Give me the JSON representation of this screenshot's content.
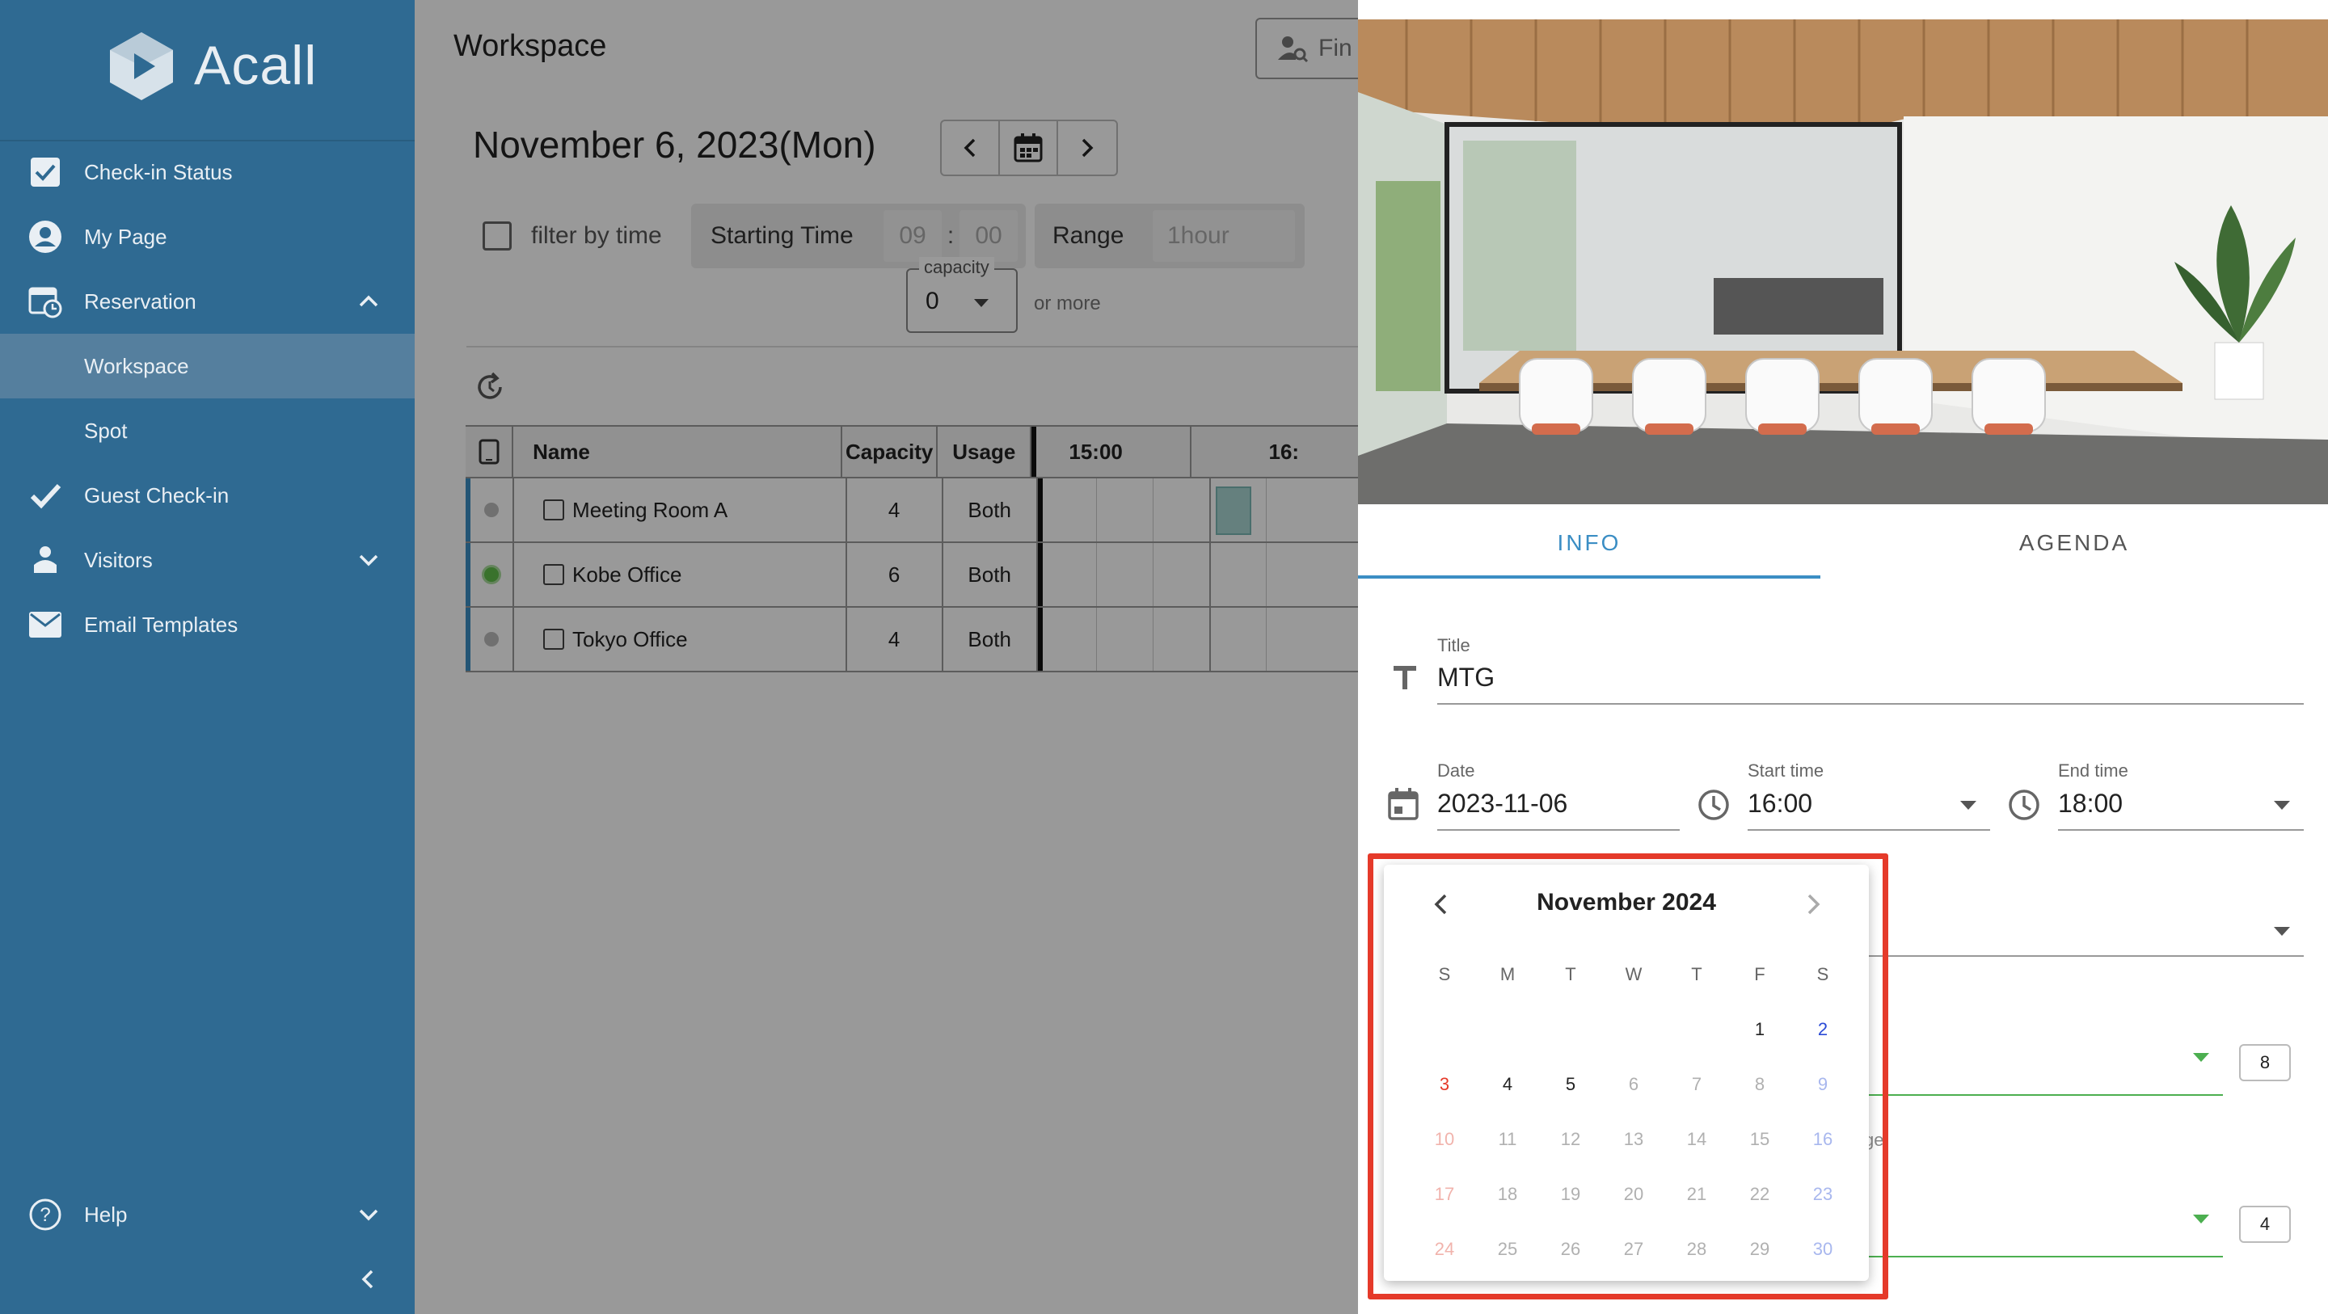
{
  "app": {
    "brand": "Acall"
  },
  "sidebar": {
    "items": [
      {
        "label": "Check-in Status"
      },
      {
        "label": "My Page"
      },
      {
        "label": "Reservation"
      },
      {
        "label": "Workspace"
      },
      {
        "label": "Spot"
      },
      {
        "label": "Guest Check-in"
      },
      {
        "label": "Visitors"
      },
      {
        "label": "Email Templates"
      }
    ],
    "help": "Help"
  },
  "main": {
    "page_title": "Workspace",
    "find_label": "Fin",
    "date_heading": "November 6, 2023(Mon)",
    "filter": {
      "filter_label": "filter by time",
      "starting_time_label": "Starting Time",
      "start_hour": "09",
      "time_separator": ":",
      "start_minute": "00",
      "range_label": "Range",
      "range_value": "1hour",
      "capacity_label": "capacity",
      "capacity_value": "0",
      "or_more": "or more"
    },
    "table": {
      "headers": {
        "name": "Name",
        "capacity": "Capacity",
        "usage": "Usage",
        "time1": "15:00",
        "time2": "16:"
      },
      "rows": [
        {
          "name": "Meeting Room A",
          "capacity": "4",
          "usage": "Both"
        },
        {
          "name": "Kobe Office",
          "capacity": "6",
          "usage": "Both"
        },
        {
          "name": "Tokyo Office",
          "capacity": "4",
          "usage": "Both"
        }
      ]
    }
  },
  "panel": {
    "tabs": {
      "info": "INFO",
      "agenda": "AGENDA"
    },
    "title_label": "Title",
    "title_value": "MTG",
    "date_label": "Date",
    "date_value": "2023-11-06",
    "start_label": "Start time",
    "start_value": "16:00",
    "end_label": "End time",
    "end_value": "18:00",
    "partial_text": "ge.",
    "count1": "8",
    "count2": "4"
  },
  "calendar": {
    "month_title": "November 2024",
    "weekdays": [
      "S",
      "M",
      "T",
      "W",
      "T",
      "F",
      "S"
    ],
    "weeks": [
      [
        "",
        "",
        "",
        "",
        "",
        "1",
        "2"
      ],
      [
        "3",
        "4",
        "5",
        "6",
        "7",
        "8",
        "9"
      ],
      [
        "10",
        "11",
        "12",
        "13",
        "14",
        "15",
        "16"
      ],
      [
        "17",
        "18",
        "19",
        "20",
        "21",
        "22",
        "23"
      ],
      [
        "24",
        "25",
        "26",
        "27",
        "28",
        "29",
        "30"
      ]
    ],
    "colors": {
      "sunday": "#e53a2a",
      "sunday_disabled": "#f1b3ac",
      "saturday": "#2b4bd6",
      "saturday_disabled": "#a8b7ee",
      "weekday": "#222222",
      "weekday_disabled": "#b0b0b0"
    },
    "enabled_days": [
      "1",
      "2",
      "3",
      "4",
      "5"
    ]
  }
}
